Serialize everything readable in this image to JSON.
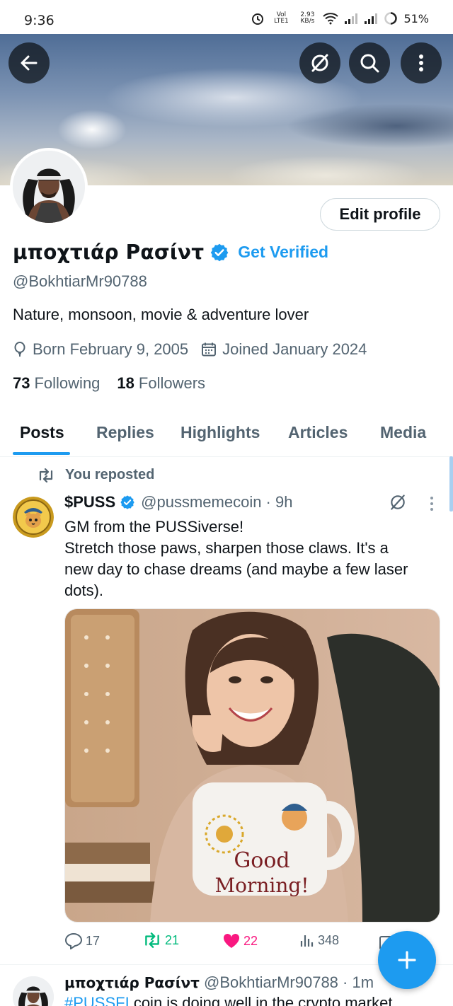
{
  "status_bar": {
    "time": "9:36",
    "net_type": "Vol LTE1",
    "net_speed_value": "2.93",
    "net_speed_unit": "KB/s",
    "battery": "51%"
  },
  "profile": {
    "display_name": "μποχτιάρ Ρασίντ",
    "verified_badge": "verified-icon",
    "get_verified_label": "Get Verified",
    "handle": "@BokhtiarMr90788",
    "bio": "Nature, monsoon, movie & adventure lover",
    "born": "Born February 9, 2005",
    "joined": "Joined January 2024",
    "following_count": "73",
    "following_label": "Following",
    "followers_count": "18",
    "followers_label": "Followers",
    "edit_profile_label": "Edit profile"
  },
  "tabs": [
    {
      "label": "Posts",
      "active": true
    },
    {
      "label": "Replies"
    },
    {
      "label": "Highlights"
    },
    {
      "label": "Articles"
    },
    {
      "label": "Media"
    }
  ],
  "post1": {
    "repost_label": "You reposted",
    "author": "$PUSS",
    "handle_time": "@pussmemecoin · 9h",
    "text_lines": [
      "GM from the PUSSiverse!",
      "Stretch those paws, sharpen those claws. It's a",
      "new day to chase dreams (and maybe a few laser",
      "dots)."
    ],
    "image_mug_text_1": "Good",
    "image_mug_text_2": "Morning!",
    "replies": "17",
    "reposts": "21",
    "likes": "22",
    "views": "348"
  },
  "post2": {
    "author": "μποχτιάρ Ρασίντ",
    "handle_time": "@BokhtiarMr90788 · 1m",
    "hashtag": "#PUSSFI",
    "text_rest": " coin is doing well in the crypto market"
  },
  "colors": {
    "accent": "#1d9bf0",
    "like": "#f91880",
    "repost": "#00ba7c",
    "secondary_text": "#536471"
  }
}
